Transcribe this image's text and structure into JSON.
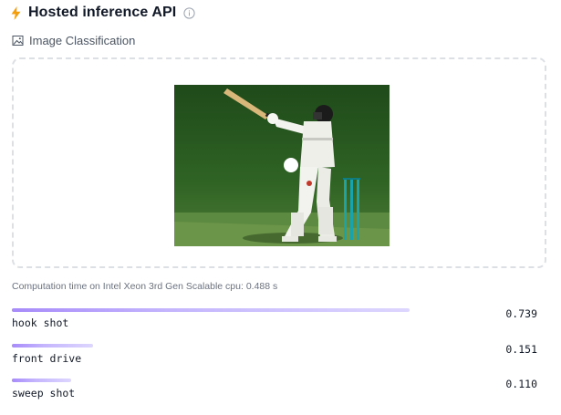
{
  "header": {
    "title": "Hosted inference API",
    "bolt_icon": "bolt-icon",
    "info_icon": "info-icon",
    "accent_color": "#f59e0b"
  },
  "task": {
    "label": "Image Classification",
    "icon": "image-classification-icon"
  },
  "dropzone": {
    "image_alt": "cricket batsman playing a hook shot"
  },
  "computation": {
    "text": "Computation time on Intel Xeon 3rd Gen Scalable cpu: 0.488 s"
  },
  "results": [
    {
      "label": "hook shot",
      "score": "0.739",
      "value": 0.739
    },
    {
      "label": "front drive",
      "score": "0.151",
      "value": 0.151
    },
    {
      "label": "sweep shot",
      "score": "0.110",
      "value": 0.11
    }
  ],
  "colors": {
    "bar_start": "#a78bfa",
    "bar_end": "#ddd6fe"
  }
}
